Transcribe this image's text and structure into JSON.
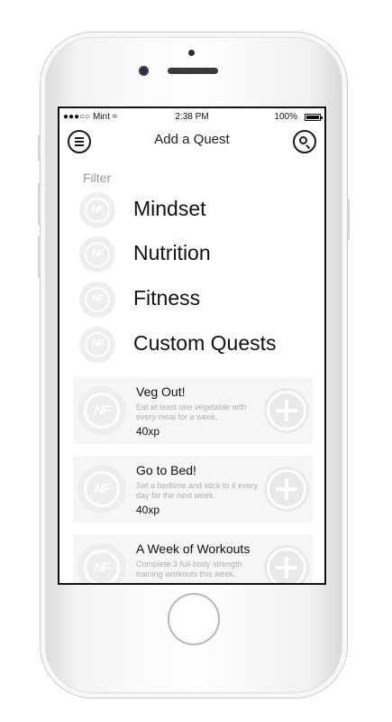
{
  "status_bar": {
    "carrier": "●●●○○ Mint ≈",
    "time": "2:38 PM",
    "battery": "100%",
    "battery_level": 1.0
  },
  "nav": {
    "title": "Add a Quest",
    "menu_icon": "hamburger-menu-icon",
    "search_icon": "search-icon"
  },
  "filter": {
    "label": "Filter",
    "categories": [
      {
        "label": "Mindset",
        "icon": "nf-logo-icon"
      },
      {
        "label": "Nutrition",
        "icon": "nf-logo-icon"
      },
      {
        "label": "Fitness",
        "icon": "nf-logo-icon"
      },
      {
        "label": "Custom Quests",
        "icon": "nf-logo-icon"
      }
    ]
  },
  "logo_text": "NF",
  "quests": [
    {
      "title": "Veg Out!",
      "description": "Eat at least one vegetable with every meal for a week.",
      "xp": "40xp"
    },
    {
      "title": "Go to Bed!",
      "description": "Set a bedtime and stick to it every day for the next week.",
      "xp": "40xp"
    },
    {
      "title": "A Week of Workouts",
      "description": "Complete 3 full-body strength training workouts this week.",
      "xp": ""
    }
  ],
  "colors": {
    "frame": "#f4f4f5",
    "screen_border": "#111111",
    "card_bg": "#f6f6f6",
    "logo_bg": "#eeeeee",
    "muted_text": "#9a9a9a"
  }
}
